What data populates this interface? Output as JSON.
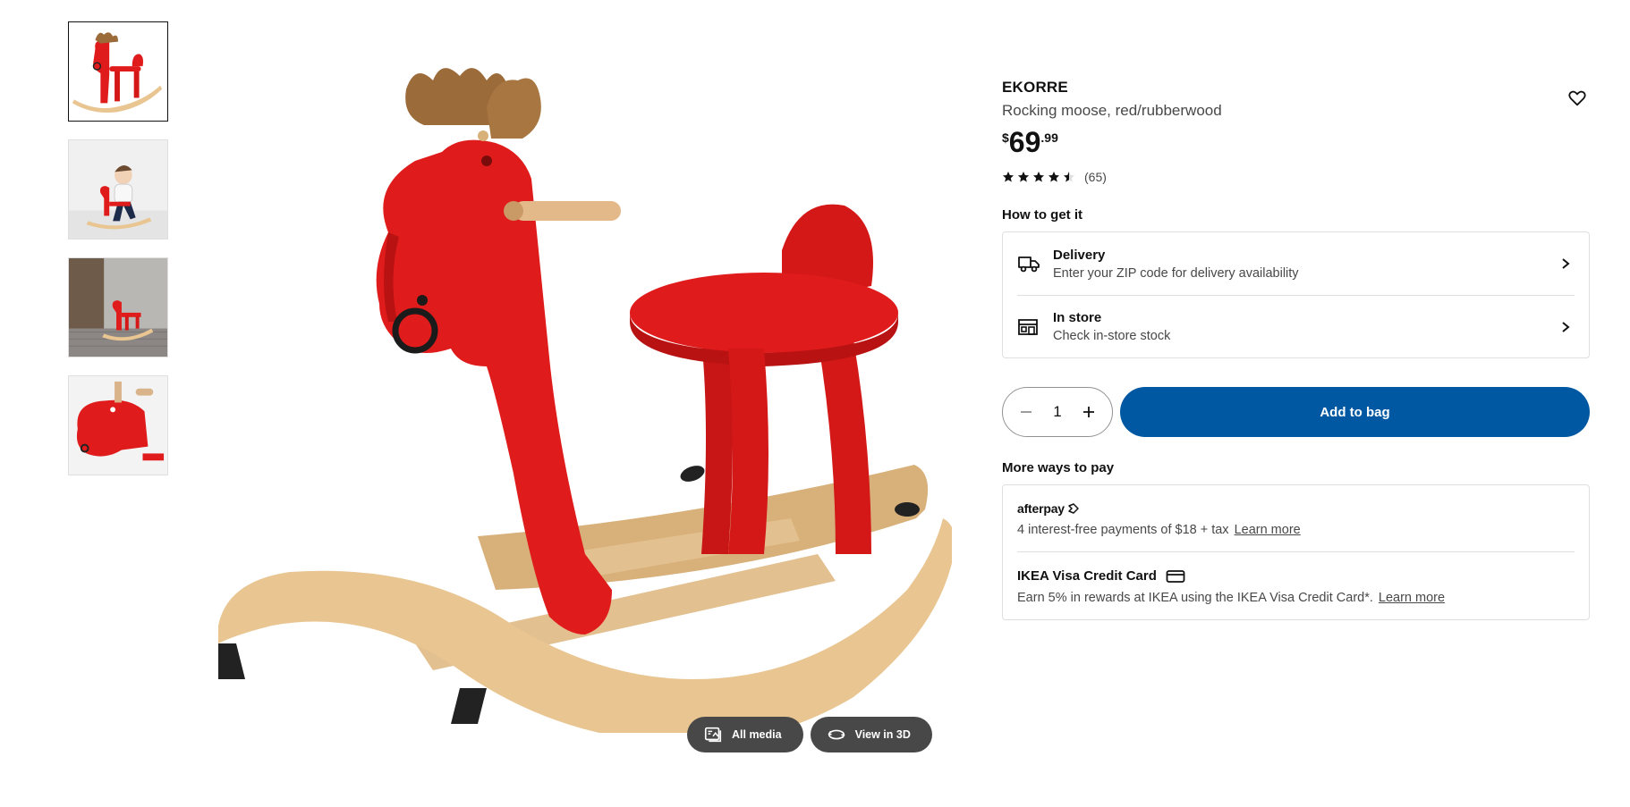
{
  "gallery": {
    "thumbnails": [
      {
        "name": "thumb-product",
        "icon": "rocking-moose-product"
      },
      {
        "name": "thumb-child-riding",
        "icon": "child-on-moose"
      },
      {
        "name": "thumb-room-scene",
        "icon": "moose-in-room"
      },
      {
        "name": "thumb-detail",
        "icon": "moose-head-detail"
      }
    ],
    "active_index": 0,
    "all_media_label": "All media",
    "view_3d_label": "View in 3D"
  },
  "product": {
    "brand": "EKORRE",
    "description": "Rocking moose, red/rubberwood",
    "price": {
      "currency": "$",
      "integer": "69",
      "decimal": ".99"
    },
    "rating": {
      "stars": 4.5,
      "count": "(65)"
    }
  },
  "get_it": {
    "title": "How to get it",
    "delivery": {
      "title": "Delivery",
      "subtitle": "Enter your ZIP code for delivery availability"
    },
    "in_store": {
      "title": "In store",
      "subtitle": "Check in-store stock"
    }
  },
  "purchase": {
    "quantity": "1",
    "add_label": "Add to bag"
  },
  "payments": {
    "title": "More ways to pay",
    "afterpay": {
      "logo": "afterpay",
      "text": "4 interest-free payments of $18 + tax",
      "link": "Learn more"
    },
    "visa": {
      "title": "IKEA Visa Credit Card",
      "text": "Earn 5% in rewards at IKEA using the IKEA Visa Credit Card*.",
      "link": "Learn more"
    }
  },
  "colors": {
    "accent": "#0058a3",
    "moose_red": "#e01b1b",
    "wood": "#e8c591",
    "dark_pill": "#484848"
  }
}
